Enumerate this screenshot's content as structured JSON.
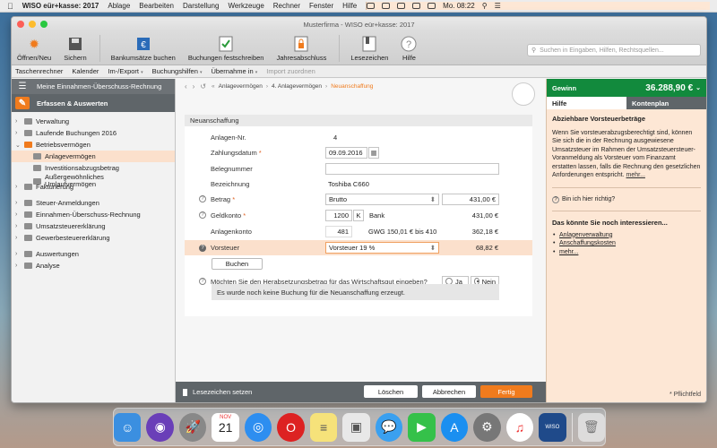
{
  "menubar": {
    "app": "WISO eür+kasse: 2017",
    "items": [
      "Ablage",
      "Bearbeiten",
      "Darstellung",
      "Werkzeuge",
      "Rechner",
      "Fenster",
      "Hilfe"
    ],
    "clock": "Mo. 08:22"
  },
  "window": {
    "title": "Musterfirma - WISO eür+kasse: 2017"
  },
  "toolbar": {
    "buttons": [
      "Öffnen/Neu",
      "Sichern",
      "Bankumsätze buchen",
      "Buchungen festschreiben",
      "Jahresabschluss",
      "Lesezeichen",
      "Hilfe"
    ],
    "search_placeholder": "Suchen in Eingaben, Hilfen, Rechtsquellen..."
  },
  "menu2": {
    "items": [
      "Taschenrechner",
      "Kalender",
      "Im-/Export",
      "Buchungshilfen",
      "Übernahme in",
      "Import zuordnen"
    ]
  },
  "sidebar": {
    "header": "Meine Einnahmen-Überschuss-Rechnung",
    "section": "Erfassen & Auswerten",
    "tree": {
      "verwaltung": "Verwaltung",
      "laufende": "Laufende Buchungen 2016",
      "betriebsvermoegen": "Betriebsvermögen",
      "anlagevermoegen": "Anlagevermögen",
      "investitions": "Investitionsabzugsbetrag",
      "ausser": "Außergewöhnliches Umlaufvermögen",
      "fakturierung": "Fakturierung",
      "steuer": "Steuer-Anmeldungen",
      "eur": "Einnahmen-Überschuss-Rechnung",
      "ust": "Umsatzsteuererklärung",
      "gewst": "Gewerbesteuererklärung",
      "auswertungen": "Auswertungen",
      "analyse": "Analyse"
    }
  },
  "breadcrumb": {
    "a": "Anlagevermögen",
    "b": "4. Anlagevermögen",
    "c": "Neuanschaffung"
  },
  "form": {
    "title": "Neuanschaffung",
    "anlagen_nr_label": "Anlagen-Nr.",
    "anlagen_nr": "4",
    "zahlungsdatum_label": "Zahlungsdatum",
    "zahlungsdatum": "09.09.2016",
    "belegnummer_label": "Belegnummer",
    "belegnummer": "",
    "bezeichnung_label": "Bezeichnung",
    "bezeichnung": "Toshiba C660",
    "betrag_label": "Betrag",
    "betrag_type": "Brutto",
    "betrag": "431,00 €",
    "geldkonto_label": "Geldkonto",
    "geldkonto": "1200",
    "geldkonto_k": "K",
    "geldkonto_name": "Bank",
    "geldkonto_val": "431,00 €",
    "anlagenkonto_label": "Anlagenkonto",
    "anlagenkonto": "481",
    "anlagenkonto_name": "GWG 150,01 € bis 410",
    "anlagenkonto_val": "362,18 €",
    "vorsteuer_label": "Vorsteuer",
    "vorsteuer": "Vorsteuer 19 %",
    "vorsteuer_val": "68,82 €",
    "buchen": "Buchen",
    "question": "Möchten Sie den Herabsetzungsbetrag für das Wirtschaftsgut eingeben?",
    "ja": "Ja",
    "nein": "Nein",
    "info": "Es wurde noch keine Buchung für die Neuanschaffung erzeugt."
  },
  "bottombar": {
    "lesezeichen": "Lesezeichen setzen",
    "loeschen": "Löschen",
    "abbrechen": "Abbrechen",
    "fertig": "Fertig"
  },
  "right": {
    "gewinn_label": "Gewinn",
    "gewinn": "36.288,90 €",
    "tab_hilfe": "Hilfe",
    "tab_kontenplan": "Kontenplan",
    "help_title": "Abziehbare Vorsteuerbeträge",
    "help_text": "Wenn Sie vorsteuerabzugsberechtigt sind, können Sie sich die in der Rechnung ausgewiesene Umsatzsteuer im Rahmen der Umsatzsteuersteuer-Voranmeldung als Vorsteuer vom Finanzamt erstatten lassen, falls die Rechnung den gesetzlichen Anforderungen entspricht.",
    "more": "mehr...",
    "richtig": "Bin ich hier richtig?",
    "interest_title": "Das könnte Sie noch interessieren...",
    "links": [
      "Anlagenverwaltung",
      "Anschaffungskosten",
      "mehr..."
    ],
    "pflicht": "* Pflichtfeld"
  },
  "colors": {
    "accent": "#f07b1d",
    "gewinn_bg": "#128a3d",
    "highlight": "#fbe0cc"
  }
}
